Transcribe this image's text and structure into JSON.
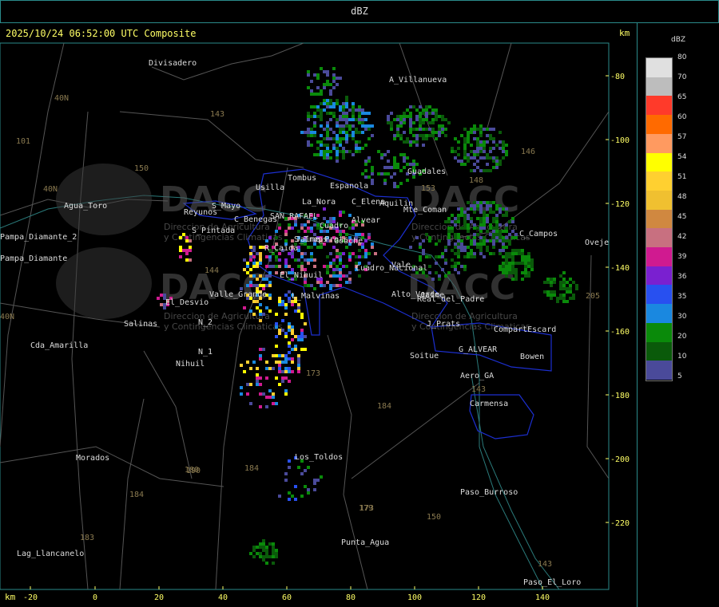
{
  "header": {
    "title": "dBZ"
  },
  "timestamp": "2025/10/24 06:52:00 UTC Composite",
  "units": {
    "km_top": "km",
    "km_bottom": "km"
  },
  "axes": {
    "x_ticks": [
      "-20",
      "0",
      "20",
      "40",
      "60",
      "80",
      "100",
      "120",
      "140"
    ],
    "y_ticks": [
      "-80",
      "-100",
      "-120",
      "-140",
      "-160",
      "-180",
      "-200",
      "-220"
    ]
  },
  "legend": {
    "title": "dBZ",
    "entries": [
      {
        "label": "80",
        "color": "#e0e0e0"
      },
      {
        "label": "70",
        "color": "#bdbdbd"
      },
      {
        "label": "65",
        "color": "#ff3a2a"
      },
      {
        "label": "60",
        "color": "#ff6a00"
      },
      {
        "label": "57",
        "color": "#ff9a60"
      },
      {
        "label": "54",
        "color": "#ffff00"
      },
      {
        "label": "51",
        "color": "#ffd030"
      },
      {
        "label": "48",
        "color": "#f0c030"
      },
      {
        "label": "45",
        "color": "#d08840"
      },
      {
        "label": "42",
        "color": "#c87080"
      },
      {
        "label": "39",
        "color": "#d01a90"
      },
      {
        "label": "36",
        "color": "#7a20d0"
      },
      {
        "label": "35",
        "color": "#2850f0"
      },
      {
        "label": "30",
        "color": "#1a88e0"
      },
      {
        "label": "20",
        "color": "#0a8a0a"
      },
      {
        "label": "10",
        "color": "#0a5a0a"
      },
      {
        "label": "5",
        "color": "#4a4a9a"
      }
    ]
  },
  "watermark": {
    "text": "DACC",
    "subtitle_1": "Direccion de Agricultura",
    "subtitle_2": "y Contingencias Climaticas"
  },
  "places": [
    "Divisadero",
    "A_Villanueva",
    "Guadales",
    "Usilla",
    "Tombus",
    "Espanola",
    "Agua_Toro",
    "Reyunos",
    "S_Mayo",
    "C_Benegas",
    "SAN_RAFAEL",
    "La_Nora",
    "C_Elena",
    "Cuadro",
    "Alvear",
    "Jaime_Prats",
    "Gouche",
    "Aquilin",
    "Pampa_Diamante",
    "S_Pintada",
    "R_Caida",
    "El_Nihuil",
    "C_Campos",
    "Vale",
    "Salinas",
    "El_Desvio",
    "Valle_Grande",
    "L_Malvinas",
    "Real_del_Padre",
    "Cda_Amarilla",
    "N_2",
    "N_1",
    "Nihuil",
    "J_Prats",
    "CompartEscard",
    "G_ALVEAR",
    "Bowen",
    "Soitue",
    "Aero_GA",
    "Carmensa",
    "Morados",
    "Los_Toldos",
    "Paso_Burroso",
    "Punta_Agua",
    "Lag_Llancanelo",
    "Paso_El_Loro",
    "Ovejeria",
    "Mte_Coman",
    "Cuadro_Nacional",
    "Pampa_Diamante_2",
    "S_Trops",
    "Jaime",
    "Alto_Verde"
  ],
  "road_numbers": [
    "143",
    "101",
    "40N",
    "40N",
    "150",
    "144",
    "190",
    "173",
    "143",
    "173",
    "184",
    "179",
    "150",
    "184",
    "183",
    "180",
    "184",
    "143",
    "146",
    "148",
    "153",
    "205",
    "40N"
  ]
}
